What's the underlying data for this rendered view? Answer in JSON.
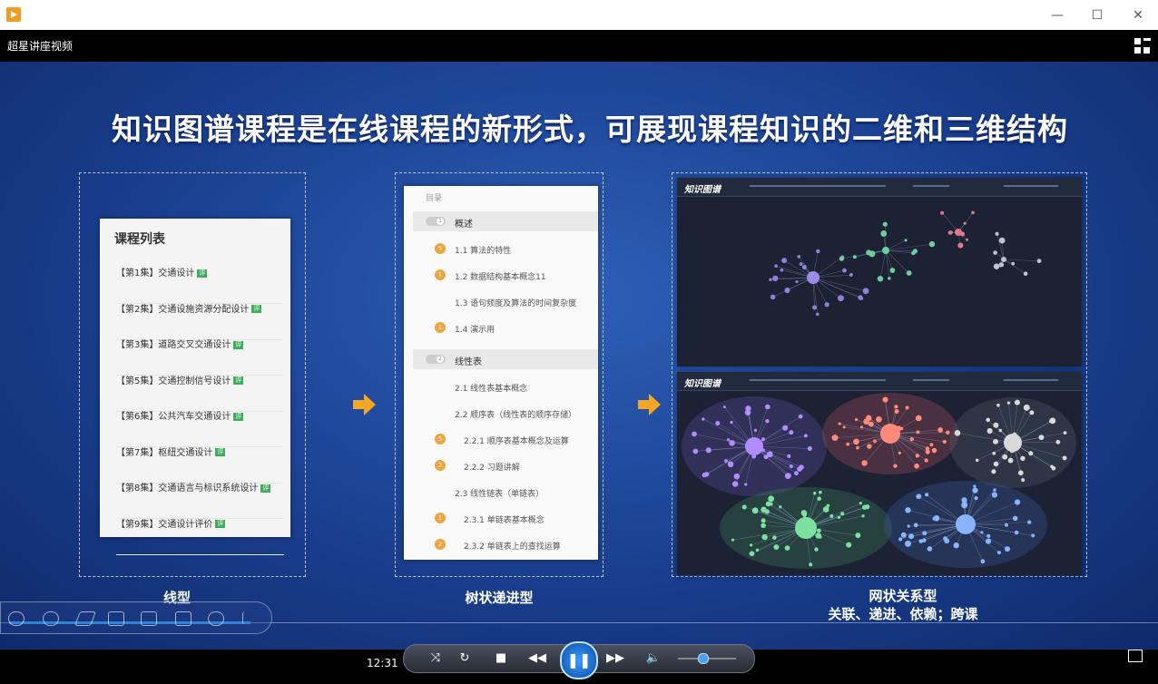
{
  "window": {
    "minimize": "—",
    "maximize": "☐",
    "close": "✕"
  },
  "app": {
    "title": "超星讲座视频"
  },
  "slide": {
    "title": "知识图谱课程是在线课程的新形式，可展现课程知识的二维和三维结构",
    "labels": {
      "linear": "线型",
      "tree": "树状递进型",
      "network": "网状关系型",
      "network_sub": "关联、递进、依赖；跨课"
    },
    "course_list": {
      "heading": "课程列表",
      "items": [
        "【第1集】交通设计",
        "【第2集】交通设施资源分配设计",
        "【第3集】道路交叉交通设计",
        "【第5集】交通控制信号设计",
        "【第6集】公共汽车交通设计",
        "【第7集】枢纽交通设计",
        "【第8集】交通语言与标识系统设计",
        "【第9集】交通设计评价"
      ],
      "tag": "评"
    },
    "tree": {
      "mulu": "目录",
      "sections": [
        {
          "num": "1",
          "title": "概述"
        },
        {
          "num": "2",
          "title": "线性表"
        }
      ],
      "items": [
        {
          "dot": "5",
          "text": "1.1 算法的特性"
        },
        {
          "dot": "1",
          "text": "1.2 数据结构基本概念11"
        },
        {
          "dot": "",
          "text": "1.3 语句频度及算法的时间复杂度"
        },
        {
          "dot": "1",
          "text": "1.4 演示用"
        },
        {
          "dot": "",
          "text": "2.1 线性表基本概念"
        },
        {
          "dot": "",
          "text": "2.2 顺序表（线性表的顺序存储）"
        },
        {
          "dot": "5",
          "text": "2.2.1 顺序表基本概念及运算"
        },
        {
          "dot": "2",
          "text": "2.2.2 习题讲解"
        },
        {
          "dot": "",
          "text": "2.3 线性链表（单链表）"
        },
        {
          "dot": "1",
          "text": "2.3.1 单链表基本概念"
        },
        {
          "dot": "2",
          "text": "2.3.2 单链表上的查找运算"
        }
      ]
    },
    "graph": {
      "logo": "知识图谱"
    }
  },
  "player": {
    "time": "12:31",
    "icons": [
      "shuffle-icon",
      "repeat-icon",
      "stop-icon",
      "rewind-icon",
      "pause-icon",
      "forward-icon",
      "volume-icon"
    ],
    "volume_level": 0.35,
    "progress": 0.22
  }
}
